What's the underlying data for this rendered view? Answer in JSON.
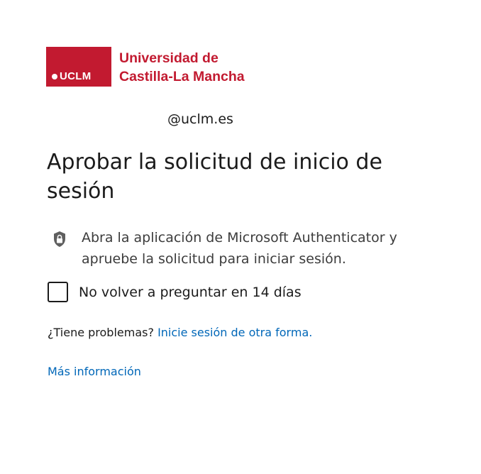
{
  "logo": {
    "box_text": "UCLM",
    "name_line1": "Universidad de",
    "name_line2": "Castilla-La Mancha",
    "brand_color": "#c21a30"
  },
  "identity": {
    "email": "@uclm.es"
  },
  "title": "Aprobar la solicitud de inicio de sesión",
  "instruction": {
    "icon": "lock-icon",
    "text": "Abra la aplicación de Microsoft Authenticator y apruebe la solicitud para iniciar sesión."
  },
  "remember": {
    "label": "No volver a preguntar en 14 días",
    "checked": false
  },
  "trouble": {
    "prefix": "¿Tiene problemas?",
    "link": "Inicie sesión de otra forma."
  },
  "more_info": "Más información",
  "colors": {
    "link": "#0067b8",
    "text": "#1b1b1b"
  }
}
